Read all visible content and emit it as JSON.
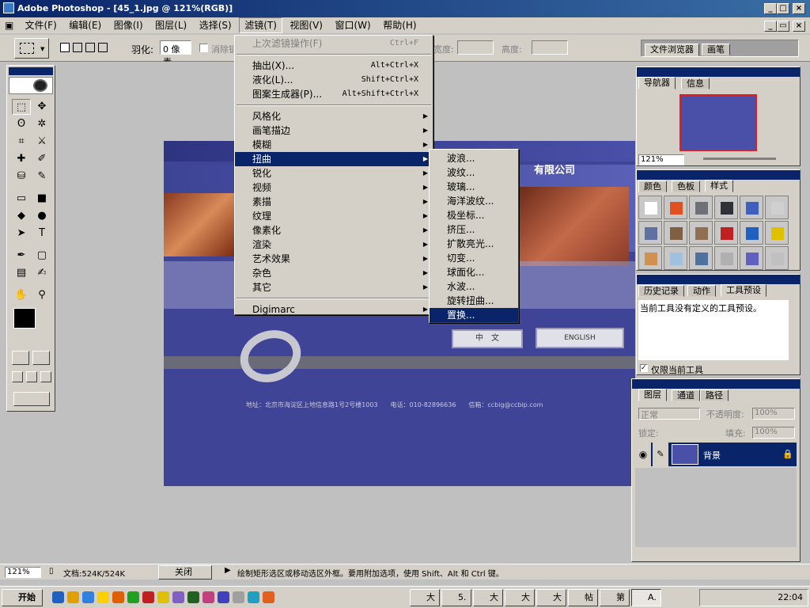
{
  "window": {
    "title": "Adobe Photoshop - [45_1.jpg @ 121%(RGB)]"
  },
  "menubar": [
    "文件(F)",
    "编辑(E)",
    "图像(I)",
    "图层(L)",
    "选择(S)",
    "滤镜(T)",
    "视图(V)",
    "窗口(W)",
    "帮助(H)"
  ],
  "options": {
    "feather_label": "羽化:",
    "feather_value": "0 像素",
    "antialias_label": "消除锯齿",
    "width_label": "宽度:",
    "height_label": "高度:",
    "palette_tabs": [
      "文件浏览器",
      "画笔"
    ]
  },
  "filter_menu": {
    "items": [
      {
        "label": "上次滤镜操作(F)",
        "shortcut": "Ctrl+F",
        "disabled": true
      },
      {
        "sep": true
      },
      {
        "label": "抽出(X)...",
        "shortcut": "Alt+Ctrl+X"
      },
      {
        "label": "液化(L)...",
        "shortcut": "Shift+Ctrl+X"
      },
      {
        "label": "图案生成器(P)...",
        "shortcut": "Alt+Shift+Ctrl+X"
      },
      {
        "sep": true
      },
      {
        "label": "风格化",
        "sub": true
      },
      {
        "label": "画笔描边",
        "sub": true
      },
      {
        "label": "模糊",
        "sub": true
      },
      {
        "label": "扭曲",
        "sub": true,
        "highlight": true
      },
      {
        "label": "锐化",
        "sub": true
      },
      {
        "label": "视频",
        "sub": true
      },
      {
        "label": "素描",
        "sub": true
      },
      {
        "label": "纹理",
        "sub": true
      },
      {
        "label": "像素化",
        "sub": true
      },
      {
        "label": "渲染",
        "sub": true
      },
      {
        "label": "艺术效果",
        "sub": true
      },
      {
        "label": "杂色",
        "sub": true
      },
      {
        "label": "其它",
        "sub": true
      },
      {
        "sep": true
      },
      {
        "label": "Digimarc",
        "sub": true
      }
    ]
  },
  "distort_submenu": [
    "波浪...",
    "波纹...",
    "玻璃...",
    "海洋波纹...",
    "极坐标...",
    "挤压...",
    "扩散亮光...",
    "切变...",
    "球面化...",
    "水波...",
    "旋转扭曲...",
    "置换..."
  ],
  "document": {
    "company_fragment": "有限公司",
    "btn_chinese": "中　文",
    "btn_english": "ENGLISH",
    "footer": "地址：北京市海淀区上地信息路1号2号楼1003　　电话：010-82896636　　信箱：ccbig@ccbip.com"
  },
  "navigator": {
    "tabs": [
      "导航器",
      "信息"
    ],
    "zoom": "121%"
  },
  "swatches": {
    "tabs": [
      "颜色",
      "色板",
      "样式"
    ]
  },
  "history": {
    "tabs": [
      "历史记录",
      "动作",
      "工具预设"
    ],
    "message": "当前工具没有定义的工具预设。",
    "checkbox_label": "仅限当前工具"
  },
  "layers": {
    "tabs": [
      "图层",
      "通道",
      "路径"
    ],
    "blend_mode": "正常",
    "opacity_label": "不透明度:",
    "opacity": "100%",
    "lock_label": "锁定:",
    "fill_label": "填充:",
    "fill": "100%",
    "layer_name": "背景"
  },
  "status": {
    "zoom": "121%",
    "doc_info": "文档:524K/524K",
    "close_label": "关闭",
    "hint": "绘制矩形选区或移动选区外框。要用附加选项，使用 Shift、Alt 和 Ctrl 键。"
  },
  "taskbar": {
    "start": "开始",
    "buttons": [
      "大",
      "5.",
      "大",
      "大",
      "大",
      "帖",
      "第",
      "A."
    ],
    "clock": "22:04"
  }
}
